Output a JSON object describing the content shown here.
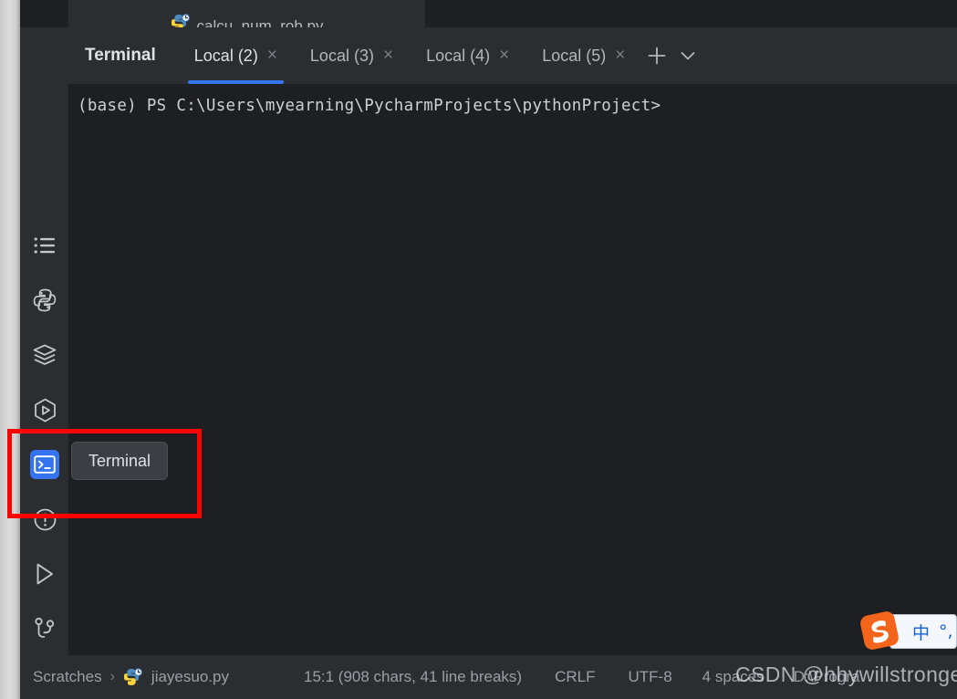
{
  "editor": {
    "tab": {
      "filename": "calcu_num_rob.py",
      "icon": "python-file-icon"
    }
  },
  "sidebar": {
    "items": [
      {
        "name": "todo",
        "icon": "list-icon",
        "tooltip": "TODO",
        "active": false
      },
      {
        "name": "python-packages",
        "icon": "python-icon",
        "tooltip": "Python Packages",
        "active": false
      },
      {
        "name": "database",
        "icon": "layers-icon",
        "tooltip": "Database",
        "active": false
      },
      {
        "name": "services",
        "icon": "services-icon",
        "tooltip": "Services",
        "active": false
      },
      {
        "name": "terminal",
        "icon": "terminal-icon",
        "tooltip": "Terminal",
        "active": true
      },
      {
        "name": "problems",
        "icon": "warning-icon",
        "tooltip": "Problems",
        "active": false
      },
      {
        "name": "run",
        "icon": "play-icon",
        "tooltip": "Run",
        "active": false
      },
      {
        "name": "git",
        "icon": "git-branch-icon",
        "tooltip": "Git",
        "active": false
      }
    ]
  },
  "tooltip": {
    "label": "Terminal"
  },
  "terminal": {
    "title": "Terminal",
    "tabs": [
      {
        "label": "Local (2)",
        "active": true,
        "close": "×"
      },
      {
        "label": "Local (3)",
        "active": false,
        "close": "×"
      },
      {
        "label": "Local (4)",
        "active": false,
        "close": "×"
      },
      {
        "label": "Local (5)",
        "active": false,
        "close": "×"
      }
    ],
    "actions": {
      "new_tab": "new-tab-icon",
      "options": "chevron-down-icon"
    },
    "lines": [
      "(base) PS C:\\Users\\myearning\\PycharmProjects\\pythonProject>"
    ],
    "active_tab_underline_color": "#3574f0"
  },
  "statusbar": {
    "breadcrumb_root": "Scratches",
    "breadcrumb_sep": "›",
    "breadcrumb_file": "jiayesuo.py",
    "caret_position": "15:1 (908 chars, 41 line breaks)",
    "line_separator": "CRLF",
    "encoding": "UTF-8",
    "indent": "4 spaces",
    "interpreter": "D:\\Progra"
  },
  "ime": {
    "logo": "sogou-logo-icon",
    "mode": "中",
    "punctuation": "°,"
  },
  "watermark": {
    "text": "CSDN @hhywillstronger"
  },
  "annotation": {
    "color": "#fe0000",
    "target": "terminal-sidebar-button"
  }
}
